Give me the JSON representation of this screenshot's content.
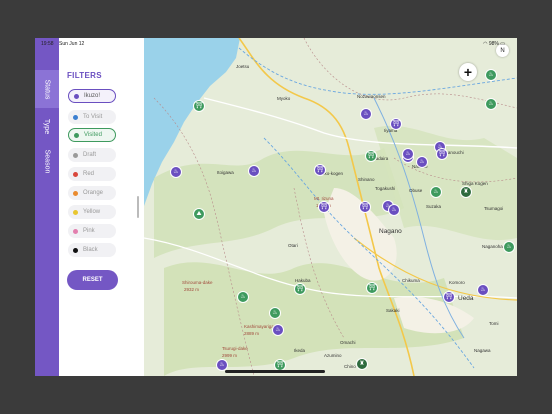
{
  "status_bar": {
    "time": "19:58",
    "date": "Sun Jun 12",
    "battery": "98%"
  },
  "tabs": [
    {
      "label": "Status",
      "active": true
    },
    {
      "label": "Type",
      "active": false
    },
    {
      "label": "Season",
      "active": false
    }
  ],
  "filters": {
    "title": "FILTERS",
    "items": [
      {
        "label": "Ikuzo!",
        "color": "#6a4fc0",
        "selected": true
      },
      {
        "label": "To Visit",
        "color": "#3b7fd0",
        "selected": false
      },
      {
        "label": "Visited",
        "color": "#3e9a5e",
        "selected": true
      },
      {
        "label": "Draft",
        "color": "#9a9a9a",
        "selected": false
      },
      {
        "label": "Red",
        "color": "#d9473c",
        "selected": false
      },
      {
        "label": "Orange",
        "color": "#e98a2e",
        "selected": false
      },
      {
        "label": "Yellow",
        "color": "#e8c62f",
        "selected": false
      },
      {
        "label": "Pink",
        "color": "#e37fae",
        "selected": false
      },
      {
        "label": "Black",
        "color": "#111111",
        "selected": false
      }
    ],
    "reset_label": "RESET"
  },
  "map": {
    "zoom_in_label": "+",
    "compass_label": "N",
    "places": {
      "joetsu": "Joetsu",
      "myoko": "Myoko",
      "nozawaonsen": "Nozawaonsen",
      "iiyama": "Iiyama",
      "nakano": "Nakano",
      "suzaka": "Suzaka",
      "obuse": "Obuse",
      "nagano": "Nagano",
      "ueda": "Ueda",
      "chikuma": "Chikuma",
      "omachi": "Omachi",
      "hakuba": "Hakuba",
      "otari": "Otari",
      "itoigawa": "Itoigawa",
      "myoko_kogen": "Myoko-kogen",
      "togakushi": "Togakushi",
      "shinano": "Shinano",
      "tsumagoi": "Tsumagoi",
      "komoro": "Komoro",
      "yamanouchi": "Yamanouchi",
      "kijimadaira": "Kijimadaira",
      "ikeda": "Ikeda",
      "azumino": "Azumino",
      "sakaki": "Sakaki",
      "tomi": "Tomi",
      "chino": "Chino",
      "nagawa": "Nagawa",
      "shiga": "Shiga Kogen",
      "naganohara": "Naganohara"
    },
    "peaks": [
      {
        "name": "Shirouma-dake",
        "height": "2932 m"
      },
      {
        "name": "Kashimayarigatake",
        "height": "2889 m"
      },
      {
        "name": "Tsurugi-dake",
        "height": "2999 m"
      },
      {
        "name": "Mt. Iizuna",
        "height": "1917 m"
      }
    ],
    "pins": [
      {
        "style": "g",
        "glyph": "⛩"
      },
      {
        "style": "g",
        "glyph": "♨"
      },
      {
        "style": "g",
        "glyph": "♨"
      },
      {
        "style": "p",
        "glyph": "♨"
      },
      {
        "style": "p",
        "glyph": "⛩"
      },
      {
        "style": "p",
        "glyph": "♨"
      },
      {
        "style": "p",
        "glyph": "♨"
      },
      {
        "style": "p",
        "glyph": "♨"
      },
      {
        "style": "p",
        "glyph": "⛩"
      },
      {
        "style": "g",
        "glyph": "⛩"
      },
      {
        "style": "p",
        "glyph": "♨"
      },
      {
        "style": "p",
        "glyph": "♨"
      },
      {
        "style": "p",
        "glyph": "⛩"
      },
      {
        "style": "p",
        "glyph": "⛩"
      },
      {
        "style": "p",
        "glyph": "♨"
      },
      {
        "style": "d",
        "glyph": "♜"
      },
      {
        "style": "p",
        "glyph": "♨"
      },
      {
        "style": "p",
        "glyph": "⛩"
      },
      {
        "style": "p",
        "glyph": "♨"
      },
      {
        "style": "g",
        "glyph": "♨"
      },
      {
        "style": "g",
        "glyph": "⛰"
      },
      {
        "style": "g",
        "glyph": "♨"
      },
      {
        "style": "g",
        "glyph": "⛩"
      },
      {
        "style": "g",
        "glyph": "♨"
      },
      {
        "style": "p",
        "glyph": "♨"
      },
      {
        "style": "p",
        "glyph": "♨"
      },
      {
        "style": "g",
        "glyph": "⛩"
      },
      {
        "style": "d",
        "glyph": "♜"
      },
      {
        "style": "p",
        "glyph": "⛩"
      },
      {
        "style": "g",
        "glyph": "⛩"
      },
      {
        "style": "p",
        "glyph": "♨"
      },
      {
        "style": "g",
        "glyph": "♨"
      }
    ]
  }
}
